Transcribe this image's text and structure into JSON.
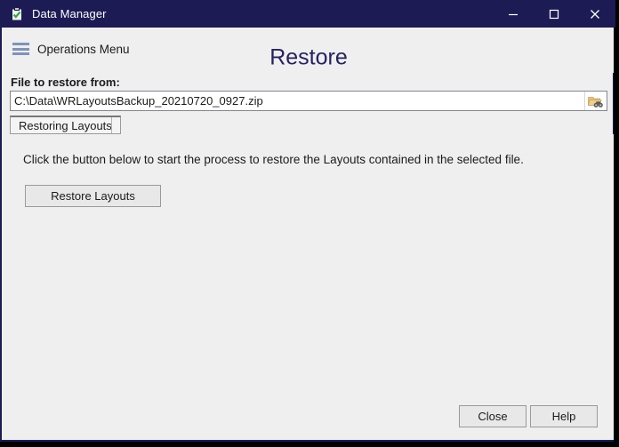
{
  "window": {
    "title": "Data Manager",
    "app_icon": "clipboard-check-icon",
    "accent_color": "#1d1b54",
    "surface_color": "#efefef",
    "controls": {
      "minimize": "minimize-icon",
      "maximize": "maximize-icon",
      "close": "close-icon"
    }
  },
  "header": {
    "menu_label": "Operations Menu",
    "menu_icon": "hamburger-icon",
    "page_title": "Restore",
    "page_title_color": "#262261"
  },
  "file_section": {
    "label": "File to restore from:",
    "path_value": "C:\\Data\\WRLayoutsBackup_20210720_0927.zip",
    "path_placeholder": "",
    "browse_icon": "folder-browse-icon"
  },
  "tabs": [
    {
      "label": "Restoring Layouts",
      "selected": true
    }
  ],
  "tab_content": {
    "instruction": "Click the button below to start the process to restore the Layouts contained in the selected file.",
    "action_button": "Restore Layouts"
  },
  "footer": {
    "close_label": "Close",
    "help_label": "Help"
  }
}
